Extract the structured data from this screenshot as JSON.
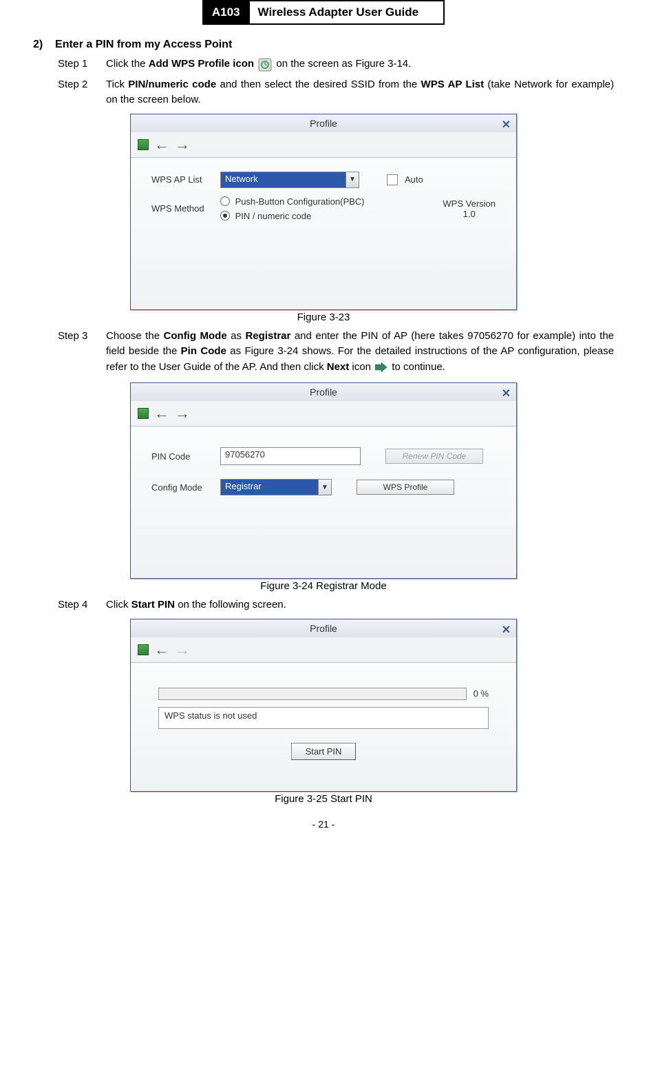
{
  "header": {
    "model": "A103",
    "guide": "Wireless Adapter User Guide"
  },
  "section": {
    "num": "2)",
    "title": "Enter a PIN from my Access Point"
  },
  "steps": {
    "s1": {
      "label": "Step 1",
      "pre": "Click the ",
      "bold1": "Add WPS Profile icon",
      "post": " on the screen as Figure 3-14."
    },
    "s2": {
      "label": "Step 2",
      "pre": "Tick ",
      "bold1": "PIN/numeric code",
      "mid": " and then select the desired SSID from the ",
      "bold2": "WPS AP List",
      "post": " (take Network for example) on the screen below."
    },
    "s3": {
      "label": "Step 3",
      "pre": "Choose the ",
      "bold1": "Config Mode",
      "mid1": " as ",
      "bold2": "Registrar",
      "mid2": " and enter the PIN of AP (here takes 97056270 for example) into the field beside the ",
      "bold3": "Pin Code",
      "mid3": " as Figure 3-24 shows. For the detailed instructions of the AP configuration, please refer to the User Guide of the AP. And then click ",
      "bold4": "Next",
      "post": " icon ",
      "post2": " to continue."
    },
    "s4": {
      "label": "Step 4",
      "pre": "Click ",
      "bold1": "Start PIN",
      "post": " on the following screen."
    }
  },
  "captions": {
    "c1": "Figure 3-23",
    "c2": "Figure 3-24 Registrar Mode",
    "c3": "Figure 3-25 Start PIN"
  },
  "dialog": {
    "title": "Profile",
    "labels": {
      "wps_ap_list": "WPS AP List",
      "wps_method": "WPS Method",
      "pbc": "Push-Button Configuration(PBC)",
      "pin_numeric": "PIN / numeric code",
      "auto": "Auto",
      "wps_version": "WPS Version",
      "version_num": "1.0",
      "pin_code": "PIN Code",
      "config_mode": "Config Mode",
      "status": "WPS status is not used"
    },
    "values": {
      "ssid": "Network",
      "pin": "97056270",
      "mode": "Registrar",
      "progress": "0 %"
    },
    "buttons": {
      "renew": "Renew PIN Code",
      "wps_profile": "WPS Profile",
      "start_pin": "Start PIN"
    }
  },
  "page_number": "- 21 -"
}
